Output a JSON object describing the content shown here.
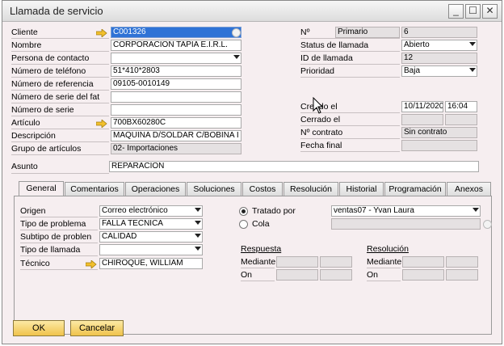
{
  "window": {
    "title": "Llamada de servicio"
  },
  "colors": {
    "selection": "#2f72d6",
    "button": "#f0c34c",
    "background": "#f6eef0"
  },
  "left": {
    "cliente": {
      "label": "Cliente",
      "value": "C001326"
    },
    "nombre": {
      "label": "Nombre",
      "value": "CORPORACION TAPIA E.I.R.L."
    },
    "persona": {
      "label": "Persona de contacto",
      "value": ""
    },
    "telefono": {
      "label": "Número de teléfono",
      "value": "51*410*2803"
    },
    "referencia": {
      "label": "Número de referencia",
      "value": "09105-0010149"
    },
    "serie_fab": {
      "label": "Número de serie del fat",
      "value": ""
    },
    "serie": {
      "label": "Número de serie",
      "value": ""
    },
    "articulo": {
      "label": "Artículo",
      "value": "700BX60280C"
    },
    "descripcion": {
      "label": "Descripción",
      "value": "MAQUINA D/SOLDAR C/BOBINA I"
    },
    "grupo": {
      "label": "Grupo de artículos",
      "value": "02- Importaciones"
    }
  },
  "right": {
    "numero": {
      "label": "Nº",
      "series": "Primario",
      "value": "6"
    },
    "status": {
      "label": "Status de llamada",
      "value": "Abierto"
    },
    "id": {
      "label": "ID de llamada",
      "value": "12"
    },
    "prioridad": {
      "label": "Prioridad",
      "value": "Baja"
    },
    "creado": {
      "label": "Creado el",
      "date": "10/11/2020",
      "time": "16:04"
    },
    "cerrado": {
      "label": "Cerrado el"
    },
    "contrato": {
      "label": "Nº contrato",
      "value": "Sin contrato"
    },
    "fecha_final": {
      "label": "Fecha final"
    }
  },
  "asunto": {
    "label": "Asunto",
    "value": "REPARACION"
  },
  "tabs": [
    "General",
    "Comentarios",
    "Operaciones",
    "Soluciones",
    "Costos",
    "Resolución",
    "Historial",
    "Programación",
    "Anexos"
  ],
  "general": {
    "origen": {
      "label": "Origen",
      "value": "Correo electrónico"
    },
    "tipo_problema": {
      "label": "Tipo de problema",
      "value": "FALLA TECNICA"
    },
    "subtipo": {
      "label": "Subtipo de problen",
      "value": "CALIDAD"
    },
    "tipo_llamada": {
      "label": "Tipo de llamada",
      "value": ""
    },
    "tecnico": {
      "label": "Técnico",
      "value": "CHIROQUE, WILLIAM"
    },
    "tratado_por": {
      "label": "Tratado por",
      "value": "ventas07 -  Yvan Laura"
    },
    "cola": {
      "label": "Cola"
    },
    "respuesta": {
      "title": "Respuesta",
      "mediante": "Mediante",
      "on": "On"
    },
    "resolucion": {
      "title": "Resolución",
      "mediante": "Mediante",
      "on": "On"
    }
  },
  "buttons": {
    "ok": "OK",
    "cancel": "Cancelar"
  }
}
